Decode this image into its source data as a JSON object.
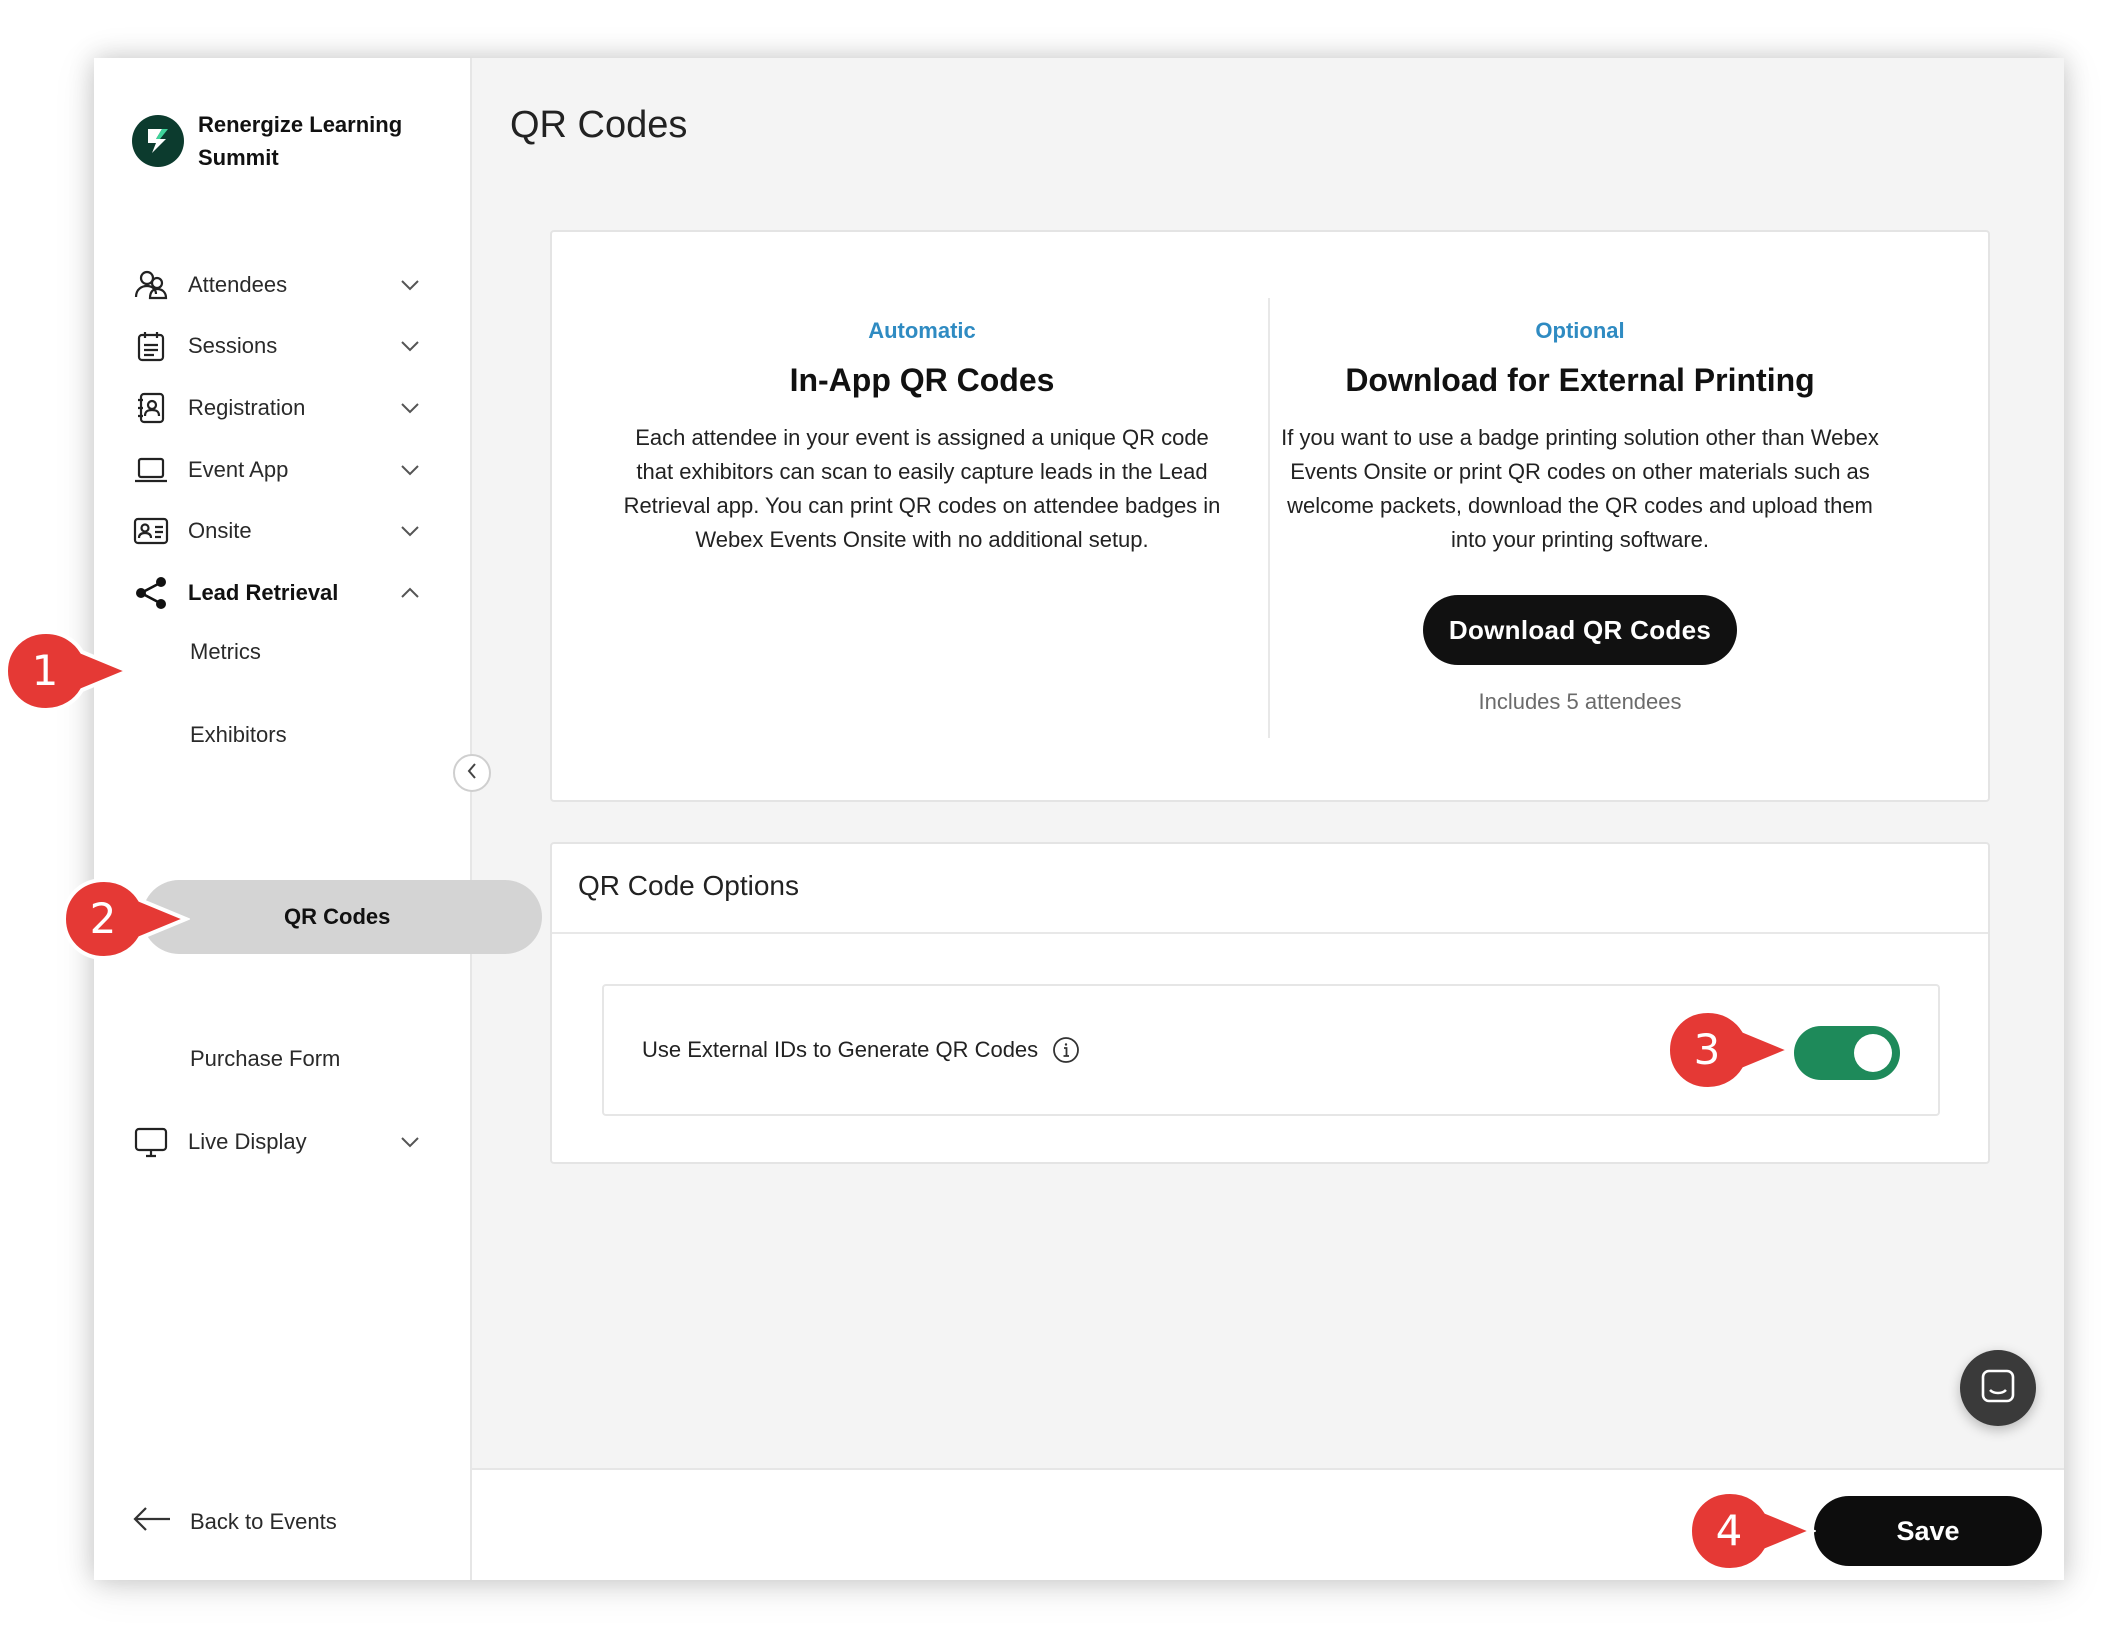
{
  "brand": {
    "name": "Renergize Learning Summit"
  },
  "page_title": "QR Codes",
  "nav": {
    "items": [
      {
        "label": "Attendees",
        "icon": "users-icon"
      },
      {
        "label": "Sessions",
        "icon": "calendar-list-icon"
      },
      {
        "label": "Registration",
        "icon": "contact-book-icon"
      },
      {
        "label": "Event App",
        "icon": "laptop-icon"
      },
      {
        "label": "Onsite",
        "icon": "id-card-icon"
      },
      {
        "label": "Lead Retrieval",
        "icon": "share-icon"
      },
      {
        "label": "Live Display",
        "icon": "monitor-icon"
      }
    ],
    "sub_items": [
      "Metrics",
      "Exhibitors",
      "QR Codes",
      "Purchase Form"
    ],
    "active_sub": "QR Codes",
    "back": "Back to Events"
  },
  "in_app": {
    "eyebrow": "Automatic",
    "title": "In-App QR Codes",
    "description": "Each attendee in your event is assigned a unique QR code that exhibitors can scan to easily capture leads in the Lead Retrieval app. You can print QR codes on attendee badges in Webex Events Onsite with no additional setup."
  },
  "external": {
    "eyebrow": "Optional",
    "title": "Download for External Printing",
    "description": "If you want to use a badge printing solution other than Webex Events Onsite or print QR codes on other materials such as welcome packets, download the QR codes and upload them into your printing software.",
    "button": "Download QR Codes",
    "includes": "Includes 5 attendees"
  },
  "options": {
    "title": "QR Code Options",
    "row_label": "Use External IDs to Generate QR Codes",
    "toggle_on": true
  },
  "footer": {
    "save": "Save"
  },
  "callouts": [
    "1",
    "2",
    "3",
    "4"
  ],
  "colors": {
    "accent_blue": "#2f8bc2",
    "toggle_green": "#1e8a5a",
    "callout_red": "#e53935"
  }
}
